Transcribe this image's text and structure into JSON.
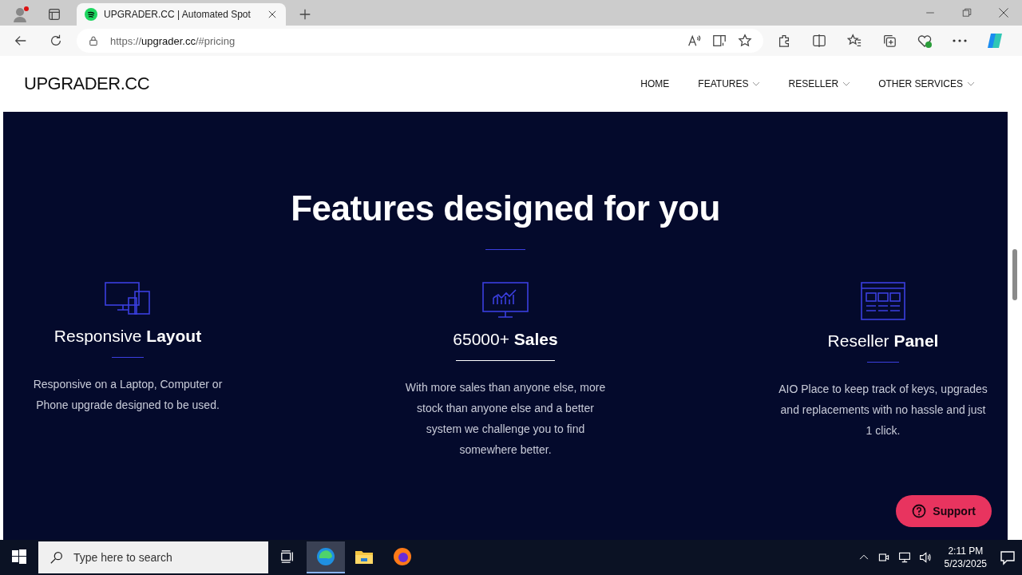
{
  "browser": {
    "tab": {
      "title": "UPGRADER.CC | Automated Spot",
      "selected": true
    },
    "address": {
      "scheme": "https://",
      "host": "upgrader.cc",
      "path": "/#pricing"
    }
  },
  "site": {
    "logo": "UPGRADER.CC",
    "nav": [
      {
        "label": "HOME",
        "kind": "link"
      },
      {
        "label": "FEATURES",
        "kind": "dropdown"
      },
      {
        "label": "RESELLER",
        "kind": "dropdown"
      },
      {
        "label": "OTHER SERVICES",
        "kind": "dropdown"
      }
    ],
    "heading": "Features designed for you",
    "features": [
      {
        "kind": "devices",
        "title": "Responsive **Layout**",
        "highlighted": false,
        "text": "Responsive on a Laptop, Computer or Phone upgrade designed to be used."
      },
      {
        "kind": "chart",
        "title": "65000+ **Sales**",
        "highlighted": true,
        "text": "With more sales than anyone else, more stock than anyone else and a better system we challenge you to find somewhere better."
      },
      {
        "kind": "panel",
        "title": "Reseller **Panel**",
        "highlighted": false,
        "text": "AIO Place to keep track of keys, upgrades and replacements with no hassle and just 1 click."
      }
    ],
    "support_button": "Support"
  },
  "taskbar": {
    "search_placeholder": "Type here to search",
    "apps": [
      {
        "kind": "edge",
        "selected": true
      },
      {
        "kind": "files",
        "selected": false
      },
      {
        "kind": "firefox",
        "selected": false
      }
    ],
    "time": "2:11 PM",
    "date": "5/23/2025"
  }
}
